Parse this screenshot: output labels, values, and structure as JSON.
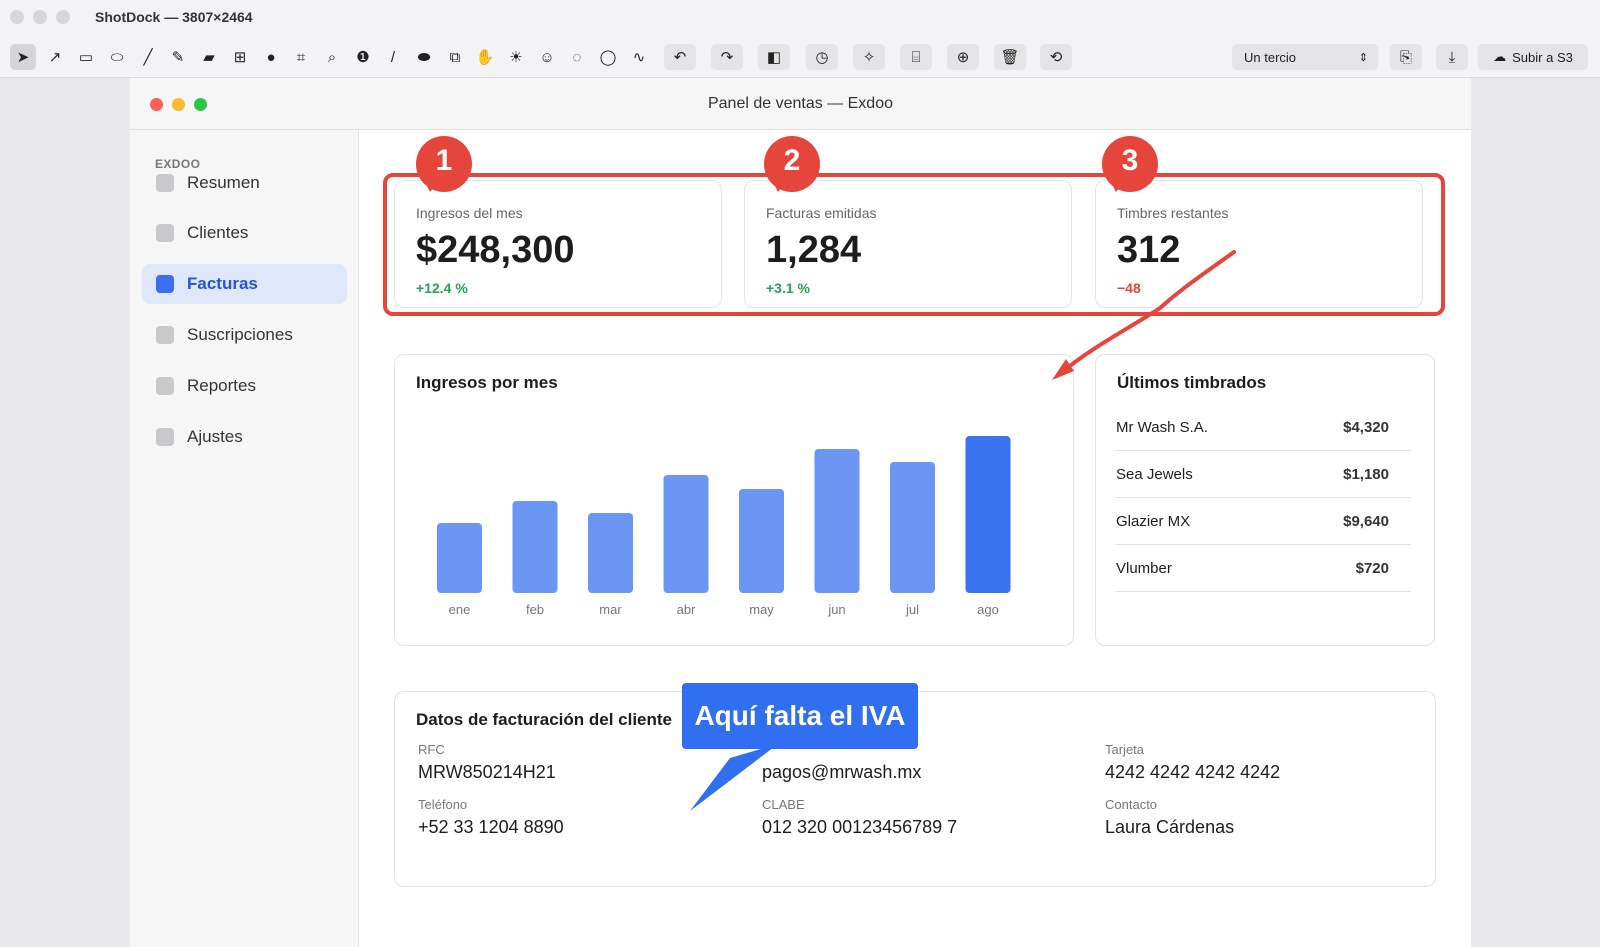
{
  "app": {
    "title": "ShotDock — 3807×2464",
    "zoom_value": "Un tercio",
    "upload_label": "Subir a S3"
  },
  "toolbar_icons": [
    "pointer-icon",
    "arrow-icon",
    "rectangle-icon",
    "ellipse-icon",
    "line-icon",
    "pen-icon",
    "speech-bubble-icon",
    "grid-icon",
    "blur-drop-icon",
    "crop-icon",
    "magnifier-icon",
    "counter-icon",
    "line-tool-icon",
    "bandage-icon",
    "copy-layer-icon",
    "hand-icon",
    "brightness-icon",
    "emoji-icon",
    "circle-select-icon",
    "lasso-icon",
    "signature-icon",
    "undo-icon",
    "redo-icon",
    "frame-icon",
    "timer-icon",
    "magic-wand-icon",
    "ocr-icon",
    "duplicate-icon",
    "trash-icon",
    "rotate-icon",
    "clipboard-icon",
    "download-icon",
    "cloud-upload-icon"
  ],
  "window": {
    "title": "Panel de ventas — Exdoo"
  },
  "sidebar": {
    "brand": "EXDOO",
    "items": [
      {
        "label": "Resumen",
        "active": false
      },
      {
        "label": "Clientes",
        "active": false
      },
      {
        "label": "Facturas",
        "active": true
      },
      {
        "label": "Suscripciones",
        "active": false
      },
      {
        "label": "Reportes",
        "active": false
      },
      {
        "label": "Ajustes",
        "active": false
      }
    ]
  },
  "kpis": [
    {
      "label": "Ingresos del mes",
      "value": "$248,300",
      "delta": "+12.4 %",
      "delta_color": "#22a355"
    },
    {
      "label": "Facturas emitidas",
      "value": "1,284",
      "delta": "+3.1 %",
      "delta_color": "#22a355"
    },
    {
      "label": "Timbres restantes",
      "value": "312",
      "delta": "−48",
      "delta_color": "#e5453b"
    }
  ],
  "annotations": {
    "badges": [
      "1",
      "2",
      "3"
    ],
    "callout": "Aquí falta el IVA",
    "red_color": "#e5453b",
    "blue_color": "#2f6ff0"
  },
  "chart": {
    "title": "Ingresos por mes"
  },
  "chart_data": {
    "type": "bar",
    "title": "Ingresos por mes",
    "categories": [
      "ene",
      "feb",
      "mar",
      "abr",
      "may",
      "jun",
      "jul",
      "ago"
    ],
    "values": [
      70,
      92,
      80,
      118,
      104,
      144,
      131,
      157
    ],
    "highlight_index": 7,
    "ylim": [
      0,
      170
    ],
    "grid": false,
    "bar_color": "#6b96f3",
    "highlight_color": "#3973ef"
  },
  "recent": {
    "title": "Últimos timbrados",
    "rows": [
      {
        "name": "Mr Wash S.A.",
        "amount": "$4,320"
      },
      {
        "name": "Sea Jewels",
        "amount": "$1,180"
      },
      {
        "name": "Glazier MX",
        "amount": "$9,640"
      },
      {
        "name": "Vlumber",
        "amount": "$720"
      }
    ]
  },
  "billing": {
    "title": "Datos de facturación del cliente",
    "fields": {
      "rfc_label": "RFC",
      "rfc_value": "MRW850214H21",
      "email_value": "pagos@mrwash.mx",
      "card_label": "Tarjeta",
      "card_value": "4242 4242 4242 4242",
      "phone_label": "Teléfono",
      "phone_value": "+52 33 1204 8890",
      "clabe_label": "CLABE",
      "clabe_value": "012 320 00123456789 7",
      "contact_label": "Contacto",
      "contact_value": "Laura Cárdenas"
    }
  }
}
